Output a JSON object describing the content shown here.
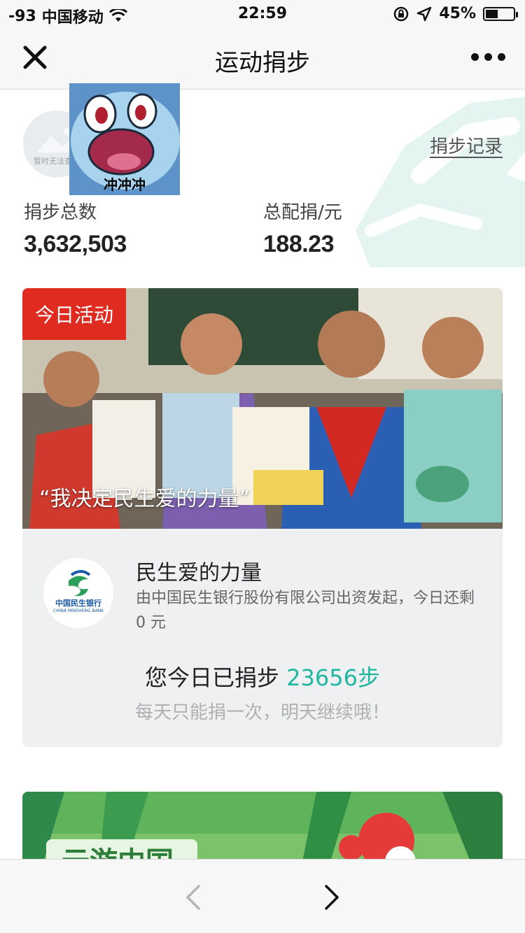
{
  "status_bar": {
    "signal": "-93",
    "carrier": "中国移动",
    "time": "22:59",
    "battery": "45%",
    "battery_level": 0.45,
    "icons": [
      "wifi-icon",
      "rotation-lock-icon",
      "location-arrow-icon",
      "battery-icon"
    ]
  },
  "nav": {
    "title": "运动捐步",
    "close_icon": "close-icon",
    "more_icon": "more-icon"
  },
  "summary": {
    "avatar_placeholder_text": "暂时无法查看",
    "sticker_caption": "冲冲冲",
    "record_link": "捐步记录",
    "total_steps_label": "捐步总数",
    "total_steps_value": "3,632,503",
    "total_money_label": "总配捐/元",
    "total_money_value": "188.23"
  },
  "activity": {
    "badge": "今日活动",
    "caption": "“我决定民生爱的力量”",
    "org_logo_name": "中国民生银行",
    "org_logo_en": "CHINA MINSHENG BANK",
    "project_title": "民生爱的力量",
    "project_desc": "由中国民生银行股份有限公司出资发起，今日还剩 0 元",
    "donated_prefix": "您今日已捐步",
    "donated_steps": "23656步",
    "donated_hint": "每天只能捐一次，明天继续哦！"
  },
  "next_card": {
    "title_partial": "云游中国"
  },
  "bottom_bar": {
    "back_icon": "chevron-left-icon",
    "forward_icon": "chevron-right-icon"
  },
  "colors": {
    "accent_green": "#1fb7a0",
    "badge_red": "#e02c20",
    "bank_blue": "#1a5aa8"
  }
}
